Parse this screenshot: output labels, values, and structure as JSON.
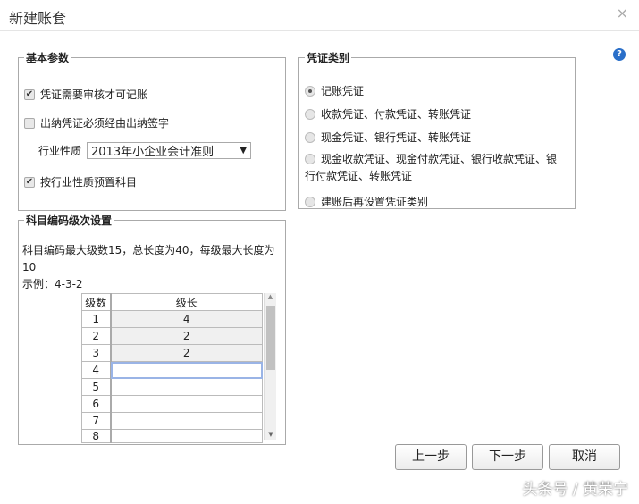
{
  "dialog": {
    "title": "新建账套",
    "close": "×"
  },
  "basic": {
    "legend": "基本参数",
    "need_audit": "凭证需要审核才可记账",
    "cashier_sign": "出纳凭证必须经由出纳签字",
    "industry_label": "行业性质",
    "industry_value": "2013年小企业会计准则",
    "preset": "按行业性质预置科目"
  },
  "voucher": {
    "legend": "凭证类别",
    "options": [
      "记账凭证",
      "收款凭证、付款凭证、转账凭证",
      "现金凭证、银行凭证、转账凭证",
      "现金收款凭证、现金付款凭证、银行收款凭证、银行付款凭证、转账凭证",
      "建账后再设置凭证类别"
    ],
    "help": "?"
  },
  "coding": {
    "legend": "科目编码级次设置",
    "desc": "科目编码最大级数15，总长度为40，每级最大长度为10",
    "example": "示例：4-3-2",
    "headers": [
      "级数",
      "级长"
    ],
    "rows": [
      [
        "1",
        "4"
      ],
      [
        "2",
        "2"
      ],
      [
        "3",
        "2"
      ],
      [
        "4",
        ""
      ],
      [
        "5",
        ""
      ],
      [
        "6",
        ""
      ],
      [
        "7",
        ""
      ],
      [
        "8",
        ""
      ]
    ]
  },
  "buttons": {
    "prev": "上一步",
    "next": "下一步",
    "cancel": "取消"
  },
  "watermark": "头条号 / 黄荣宁"
}
